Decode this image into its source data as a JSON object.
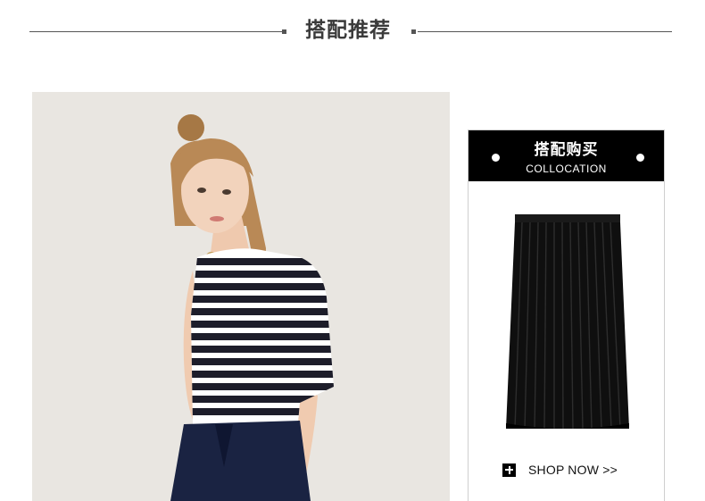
{
  "header": {
    "title": "搭配推荐"
  },
  "collocation_card": {
    "title": "搭配购买",
    "subtitle": "COLLOCATION",
    "shop_label": "SHOP NOW >>",
    "product_image": "black-pleated-skirt"
  },
  "model_photo": {
    "description": "model-striped-tee-navy-trousers"
  },
  "colors": {
    "header_text": "#3a3a3a",
    "card_header_bg": "#000000",
    "photo_bg": "#e9e6e1"
  }
}
